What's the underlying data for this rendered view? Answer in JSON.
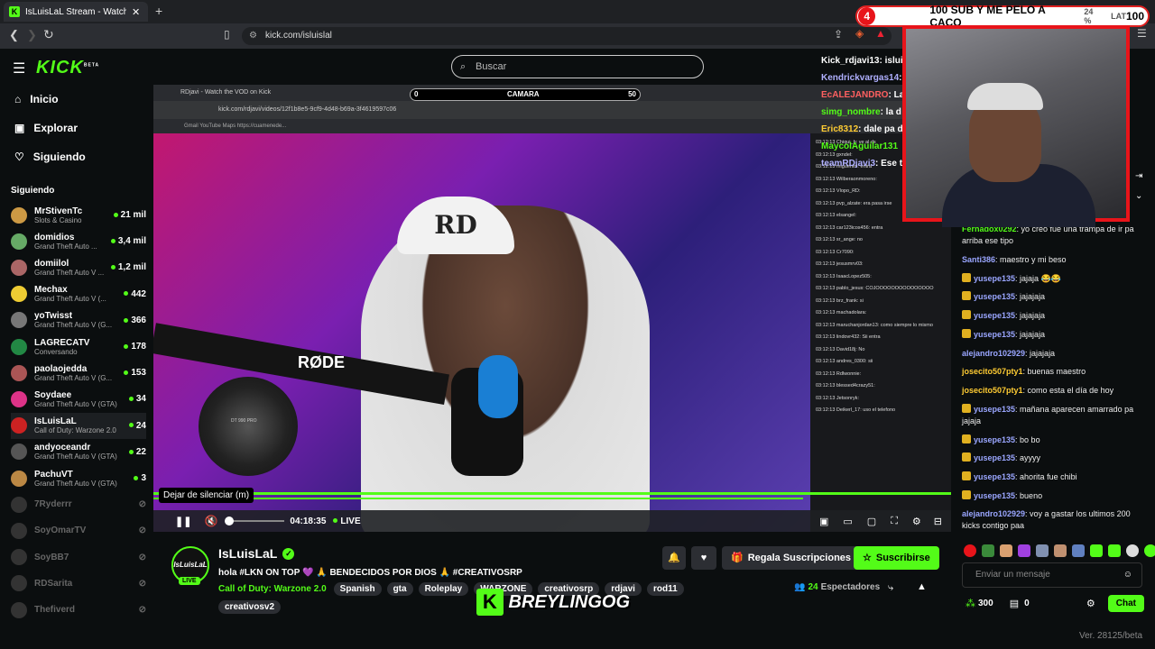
{
  "browser": {
    "tab_title": "IsLuisLaL Stream - Watch Live",
    "url": "kick.com/isluislal",
    "new_tab": "+"
  },
  "overlay": {
    "banner_left": "4",
    "banner_text": "100 SUB Y ME PELO A CACO",
    "banner_pct": "24 %",
    "banner_right": "100",
    "banner_tag": "LAT"
  },
  "sidebar": {
    "logo": "KICK",
    "logo_beta": "BETA",
    "nav": [
      {
        "label": "Inicio",
        "icon": "home-icon"
      },
      {
        "label": "Explorar",
        "icon": "compass-icon"
      },
      {
        "label": "Siguiendo",
        "icon": "heart-icon"
      }
    ],
    "section_title": "Siguiendo",
    "channels": [
      {
        "name": "MrStivenTc",
        "game": "Slots & Casino",
        "viewers": "21 mil",
        "live": true
      },
      {
        "name": "domidios",
        "game": "Grand Theft Auto ...",
        "viewers": "3,4 mil",
        "live": true
      },
      {
        "name": "domiilol",
        "game": "Grand Theft Auto V ...",
        "viewers": "1,2 mil",
        "live": true
      },
      {
        "name": "Mechax",
        "game": "Grand Theft Auto V (...",
        "viewers": "442",
        "live": true
      },
      {
        "name": "yoTwisst",
        "game": "Grand Theft Auto V (G...",
        "viewers": "366",
        "live": true
      },
      {
        "name": "LAGRECATV",
        "game": "Conversando",
        "viewers": "178",
        "live": true
      },
      {
        "name": "paolaojedda",
        "game": "Grand Theft Auto V (G...",
        "viewers": "153",
        "live": true
      },
      {
        "name": "Soydaee",
        "game": "Grand Theft Auto V (GTA)",
        "viewers": "34",
        "live": true
      },
      {
        "name": "IsLuisLaL",
        "game": "Call of Duty: Warzone 2.0",
        "viewers": "24",
        "live": true
      },
      {
        "name": "andyoceandr",
        "game": "Grand Theft Auto V (GTA)",
        "viewers": "22",
        "live": true
      },
      {
        "name": "PachuVT",
        "game": "Grand Theft Auto V (GTA)",
        "viewers": "3",
        "live": true
      },
      {
        "name": "7Ryderrr",
        "game": "",
        "viewers": "",
        "live": false
      },
      {
        "name": "SoyOmarTV",
        "game": "",
        "viewers": "",
        "live": false
      },
      {
        "name": "SoyBB7",
        "game": "",
        "viewers": "",
        "live": false
      },
      {
        "name": "RDSarita",
        "game": "",
        "viewers": "",
        "live": false
      },
      {
        "name": "Thefiverd",
        "game": "",
        "viewers": "",
        "live": false
      }
    ]
  },
  "search": {
    "placeholder": "Buscar"
  },
  "player": {
    "inner_tab": "RDjavi - Watch the VOD on Kick",
    "inner_url": "kick.com/rdjavi/videos/12f1b8e5-9cf9-4d48-b69a-3f4619597c06",
    "inner_bookmarks": "Gmail   YouTube   Maps   https://cuamenede...",
    "camara_left": "0",
    "camara_label": "CAMARA",
    "camara_right": "50",
    "cap_logo": "RD",
    "mic_brand": "RØDE",
    "headset_brand": "DT 990 PRO",
    "inner_chat": [
      "03:12:13  Chiqui_b: ve al ds",
      "03:12:13  gxndel:",
      "03:12:13  miguenini: entra",
      "03:12:13  Wilberaonmoreno:",
      "03:12:13  Vlopo_RD:",
      "03:12:13  pvp_alzate: era pasa irse",
      "03:12:13  elsangel:",
      "03:12:13  car123icos456: entra",
      "03:12:13  sr_ange: no",
      "03:12:13  Cr7090:",
      "03:12:13  jesusmrv03:",
      "03:12:13  IsaacLopez505:",
      "03:12:13  pablo_jesus: COJOOOOOOOOOOOOOOO",
      "03:12:13  brz_frank: si",
      "03:12:13  machadolara:",
      "03:12:13  maruchanjordan13: como siempre lo mismo",
      "03:12:13  lindovr432: Sii entra",
      "03:12:13  David18j: No",
      "03:12:13  andres_0300: sii",
      "03:12:13  Rdlwonnie:",
      "03:12:13  blessed4crazy51:",
      "03:12:13  Jetsonryk:",
      "03:12:13  Deikerl_17: uso el telefono"
    ],
    "tooltip": "Dejar de silenciar (m)",
    "time": "04:18:35",
    "live_label": "LIVE"
  },
  "stream_info": {
    "avatar_text": "IsLuisLaL",
    "live_badge": "LIVE",
    "streamer": "IsLuisLaL",
    "title": "hola #LKN ON TOP 💜 🙏 BENDECIDOS POR DIOS 🙏 #CREATIVOSRP",
    "category": "Call of Duty: Warzone 2.0",
    "tags": [
      "Spanish",
      "gta",
      "Roleplay",
      "WARZONE",
      "creativosrp",
      "rdjavi",
      "rod11"
    ],
    "tag_extra": "creativosv2",
    "gift_label": "Regala Suscripciones",
    "subscribe_label": "Suscribirse",
    "viewers": "24",
    "viewers_label": "Espectadores"
  },
  "watermark": {
    "letter": "K",
    "name": "BREYLINGOG"
  },
  "top_chat": [
    {
      "user": "Kick_rdjavi13",
      "text": ": isluisl",
      "color": "#ffffff"
    },
    {
      "user": "Kendrickvargas14",
      "text": ": ...",
      "color": "#b0b0ff"
    },
    {
      "user": "EcALEJANDRO",
      "text": ": La",
      "color": "#ff6060"
    },
    {
      "user": "simg_nombre",
      "text": ": la d",
      "color": "#53fc18"
    },
    {
      "user": "Eric8312",
      "text": ": dale pa d",
      "color": "#ffcc33"
    },
    {
      "user": "MaycolAguilar131",
      "text": "",
      "color": "#53fc18"
    },
    {
      "user": "teamRDjavi3",
      "text": ": Ese t",
      "color": "#b0b0ff"
    }
  ],
  "chat": [
    {
      "user": "Fernadox0292",
      "text": ": yo creo fue una trampa de ir pa arriba ese tipo",
      "color": "#53fc18",
      "badge": false
    },
    {
      "user": "Santi386",
      "text": ": maestro y mi beso",
      "color": "#9aa6ff",
      "badge": false
    },
    {
      "user": "yusepe135",
      "text": ": jajaja 😂😂",
      "color": "#9aa6ff",
      "badge": true
    },
    {
      "user": "yusepe135",
      "text": ": jajajaja",
      "color": "#9aa6ff",
      "badge": true
    },
    {
      "user": "yusepe135",
      "text": ": jajajaja",
      "color": "#9aa6ff",
      "badge": true
    },
    {
      "user": "yusepe135",
      "text": ": jajajaja",
      "color": "#9aa6ff",
      "badge": true
    },
    {
      "user": "alejandro102929",
      "text": ": jajajaja",
      "color": "#9aa6ff",
      "badge": false
    },
    {
      "user": "josecito507pty1",
      "text": ": buenas maestro",
      "color": "#ffcc33",
      "badge": false
    },
    {
      "user": "josecito507pty1",
      "text": ": como esta el día de hoy",
      "color": "#ffcc33",
      "badge": false
    },
    {
      "user": "yusepe135",
      "text": ": mañana aparecen amarrado pa jajaja",
      "color": "#9aa6ff",
      "badge": true
    },
    {
      "user": "yusepe135",
      "text": ": bo bo",
      "color": "#9aa6ff",
      "badge": true
    },
    {
      "user": "yusepe135",
      "text": ": ayyyy",
      "color": "#9aa6ff",
      "badge": true
    },
    {
      "user": "yusepe135",
      "text": ": ahorita fue chibi",
      "color": "#9aa6ff",
      "badge": true
    },
    {
      "user": "yusepe135",
      "text": ": bueno",
      "color": "#9aa6ff",
      "badge": true
    },
    {
      "user": "alejandro102929",
      "text": ": voy a gastar los ultimos 200 kicks contigo paa",
      "color": "#9aa6ff",
      "badge": false
    }
  ],
  "chat_input": {
    "placeholder": "Enviar un mensaje"
  },
  "chat_footer": {
    "points": "300",
    "count": "0",
    "chat_button": "Chat"
  },
  "version": "Ver. 28125/beta",
  "colors": {
    "accent": "#53fc18",
    "bg": "#0b0e0f",
    "overlay_red": "#e8141a"
  }
}
